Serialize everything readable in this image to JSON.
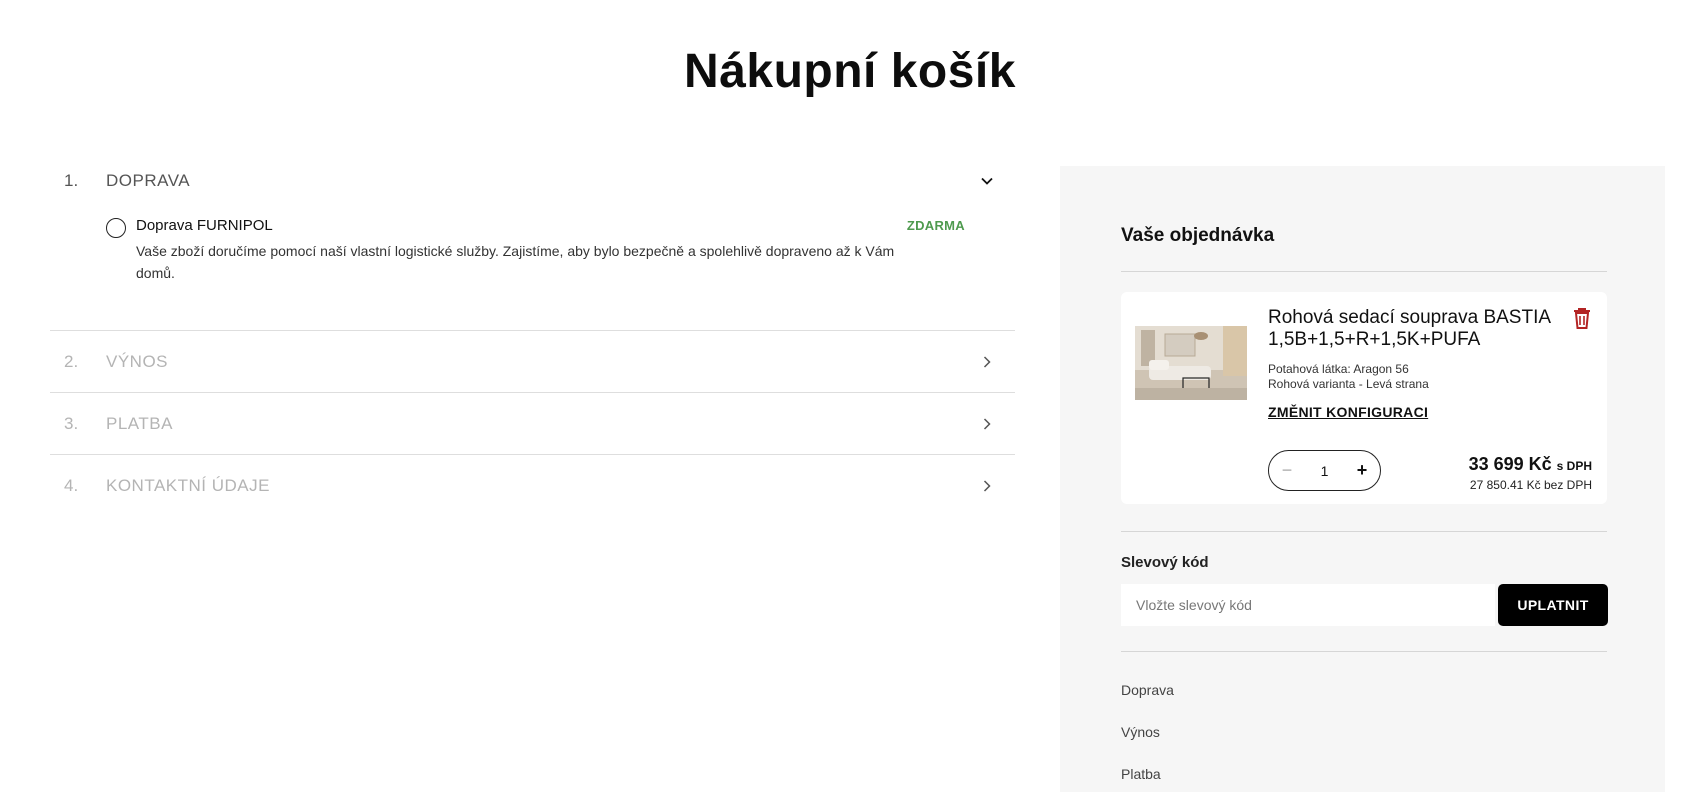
{
  "page": {
    "title": "Nákupní košík"
  },
  "steps": [
    {
      "number": "1.",
      "title": "DOPRAVA",
      "state": "expanded"
    },
    {
      "number": "2.",
      "title": "VÝNOS",
      "state": "collapsed"
    },
    {
      "number": "3.",
      "title": "PLATBA",
      "state": "collapsed"
    },
    {
      "number": "4.",
      "title": "KONTAKTNÍ ÚDAJE",
      "state": "collapsed"
    }
  ],
  "shipping": {
    "option_name": "Doprava FURNIPOL",
    "option_description": "Vaše zboží doručíme pomocí naší vlastní logistické služby. Zajistíme, aby bylo bezpečně a spolehlivě dopraveno až k Vám domů.",
    "option_price": "ZDARMA"
  },
  "summary": {
    "title": "Vaše objednávka",
    "product": {
      "name": "Rohová sedací souprava BASTIA 1,5B+1,5+R+1,5K+PUFA",
      "attr_fabric": "Potahová látka: Aragon 56",
      "attr_variant": "Rohová varianta - Levá strana",
      "change_label": "ZMĚNIT KONFIGURACI",
      "quantity": "1",
      "price_vat": "33 699 Kč",
      "price_vat_suffix": "s DPH",
      "price_novat": "27 850.41 Kč bez DPH"
    },
    "coupon": {
      "label": "Slevový kód",
      "placeholder": "Vložte slevový kód",
      "button": "UPLATNIT"
    },
    "rows": [
      "Doprava",
      "Výnos",
      "Platba"
    ]
  },
  "colors": {
    "accent_green": "#4e9a4e",
    "trash_red": "#b32424",
    "panel_bg": "#f6f6f6"
  }
}
